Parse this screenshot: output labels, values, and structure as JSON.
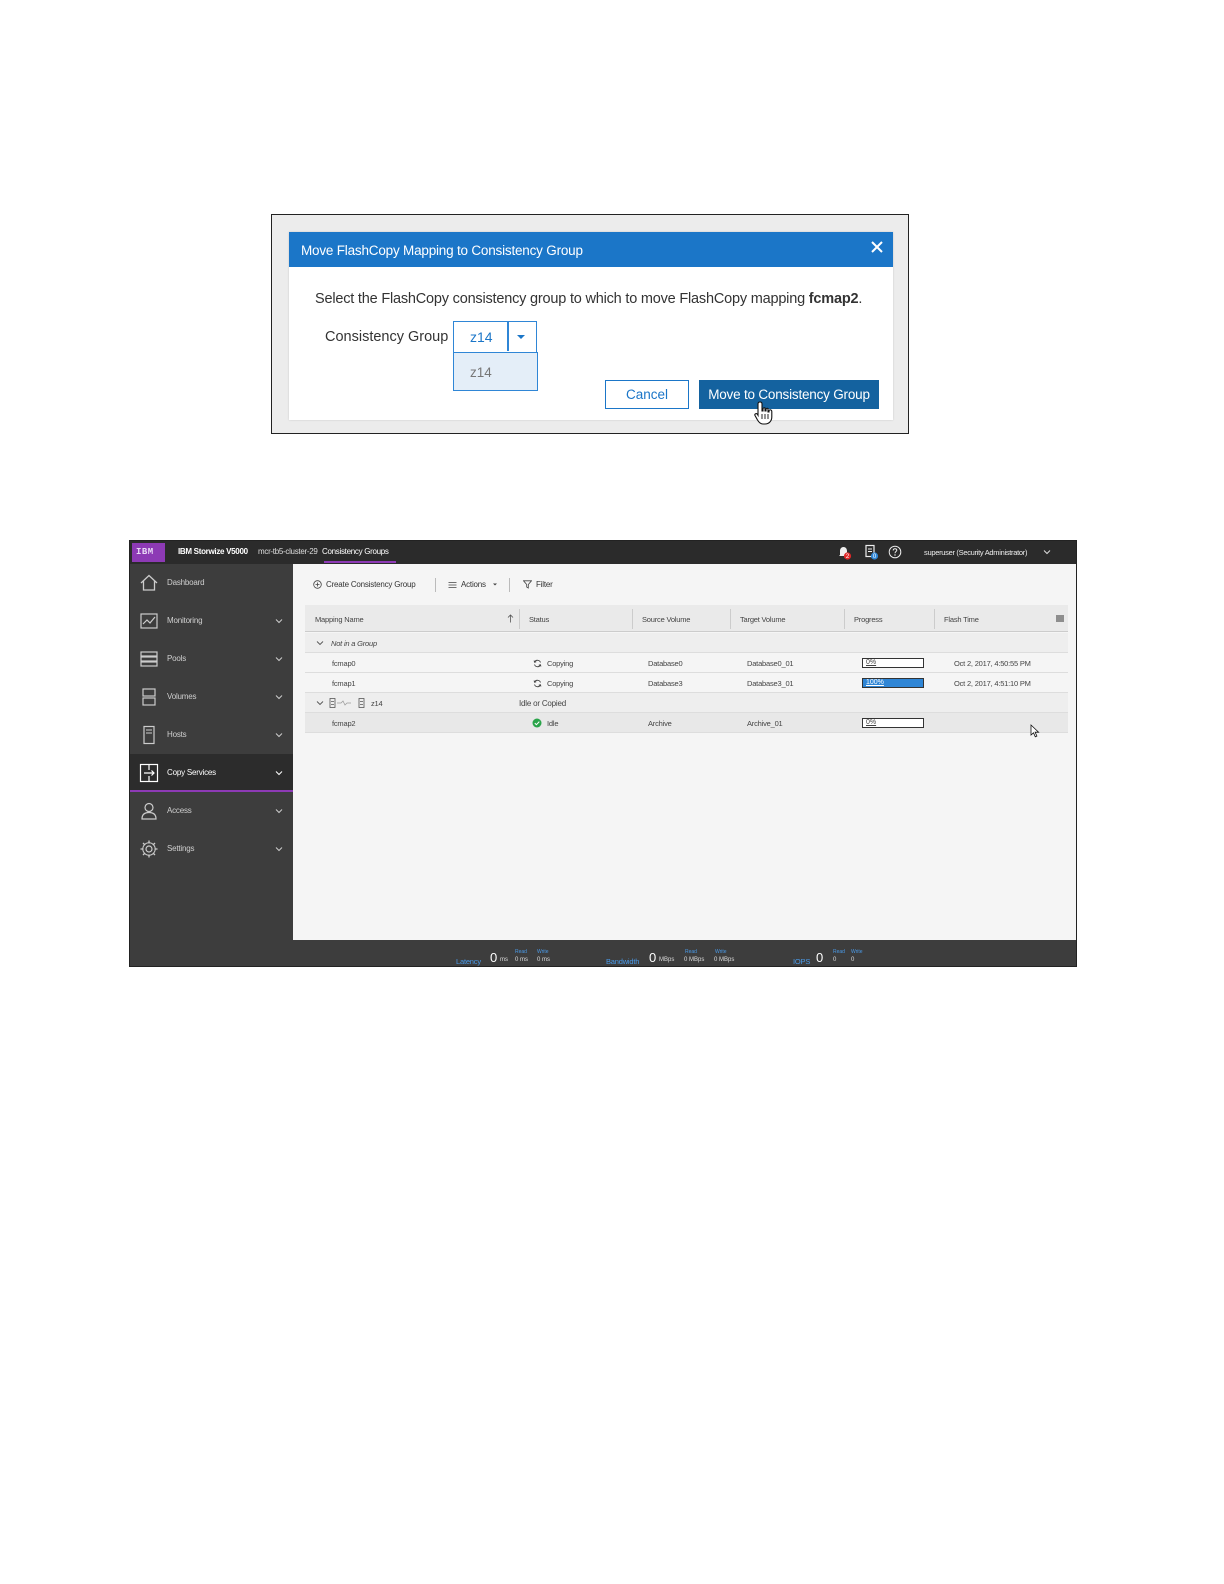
{
  "dialog": {
    "title": "Move FlashCopy Mapping to Consistency Group",
    "message_prefix": "Select the FlashCopy consistency group to which to move FlashCopy mapping ",
    "mapping_name": "fcmap2",
    "message_suffix": ".",
    "field_label": "Consistency Group",
    "selected_value": "z14",
    "options": [
      "z14"
    ],
    "cancel_label": "Cancel",
    "move_label": "Move to Consistency Group"
  },
  "app": {
    "product_name": "IBM Storwize V5000",
    "cluster_name": "mcr-tb5-cluster-29",
    "breadcrumb": "Consistency Groups",
    "logo_text": "IBM",
    "notification_count": "2",
    "task_count": "0",
    "user": "superuser (Security Administrator)",
    "accent_color": "#8d3ab5",
    "nav": [
      {
        "label": "Dashboard",
        "icon": "home-icon"
      },
      {
        "label": "Monitoring",
        "icon": "monitoring-icon"
      },
      {
        "label": "Pools",
        "icon": "pools-icon"
      },
      {
        "label": "Volumes",
        "icon": "volumes-icon"
      },
      {
        "label": "Hosts",
        "icon": "hosts-icon"
      },
      {
        "label": "Copy Services",
        "icon": "copy-services-icon"
      },
      {
        "label": "Access",
        "icon": "access-icon"
      },
      {
        "label": "Settings",
        "icon": "settings-icon"
      }
    ],
    "toolbar": {
      "create": "Create Consistency Group",
      "actions": "Actions",
      "filter": "Filter"
    },
    "columns": [
      "Mapping Name",
      "Status",
      "Source Volume",
      "Target Volume",
      "Progress",
      "Flash Time"
    ],
    "groups": [
      {
        "name": "Not in a Group",
        "status": "",
        "rows": [
          {
            "name": "fcmap0",
            "status": "Copying",
            "source": "Database0",
            "target": "Database0_01",
            "progress": "0%",
            "progress_value": 0,
            "flash_time": "Oct 2, 2017, 4:50:55 PM"
          },
          {
            "name": "fcmap1",
            "status": "Copying",
            "source": "Database3",
            "target": "Database3_01",
            "progress": "100%",
            "progress_value": 100,
            "flash_time": "Oct 2, 2017, 4:51:10 PM"
          }
        ]
      },
      {
        "name": "z14",
        "status": "Idle or Copied",
        "rows": [
          {
            "name": "fcmap2",
            "status": "Idle",
            "source": "Archive",
            "target": "Archive_01",
            "progress": "0%",
            "progress_value": 0,
            "flash_time": ""
          }
        ]
      }
    ],
    "status_bar": {
      "latency": {
        "label": "Latency",
        "value": "0",
        "unit": "ms",
        "read_label": "Read",
        "write_label": "Write",
        "read": "0 ms",
        "write": "0 ms"
      },
      "bandwidth": {
        "label": "Bandwidth",
        "value": "0",
        "unit": "MBps",
        "read_label": "Read",
        "write_label": "Write",
        "read": "0 MBps",
        "write": "0 MBps"
      },
      "iops": {
        "label": "IOPS",
        "value": "0",
        "read_label": "Read",
        "write_label": "Write",
        "read": "0",
        "write": "0"
      }
    }
  }
}
